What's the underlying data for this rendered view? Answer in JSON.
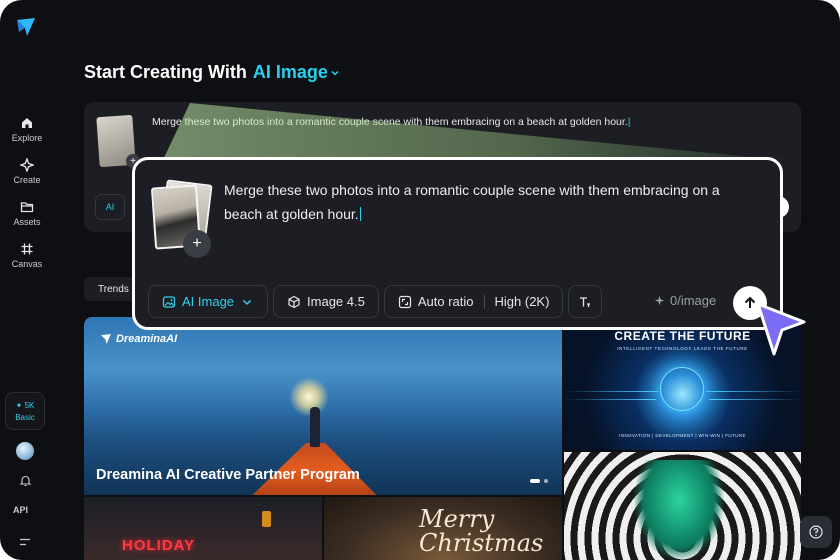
{
  "sidebar": {
    "items": [
      {
        "label": "Explore",
        "icon": "home-icon"
      },
      {
        "label": "Create",
        "icon": "sparkle-icon"
      },
      {
        "label": "Assets",
        "icon": "folder-icon"
      },
      {
        "label": "Canvas",
        "icon": "hash-icon"
      }
    ],
    "credits": "5K",
    "plan": "Basic",
    "api_label": "API"
  },
  "heading": {
    "prefix": "Start Creating With",
    "mode": "AI Image"
  },
  "background_prompt": {
    "text": "Merge these two photos into a romantic couple scene with them embracing on a beach at golden hour.",
    "mode_short": "AI"
  },
  "tabs": {
    "active": "Trends"
  },
  "gallery": {
    "banner_brand": "DreaminaAI",
    "banner_title": "Dreamina AI Creative Partner Program",
    "future_title": "CREATE THE FUTURE",
    "future_subtitle": "INTELLIGENT TECHNOLOGY LEADS THE FUTURE",
    "future_footer": "INNOVATION | DEVELOPMENT | WIN-WIN | FUTURE",
    "holiday_sign": "HOLIDAY",
    "xmas_script": "Merry Christmas"
  },
  "prompt_card": {
    "text": "Merge these two photos into a romantic couple scene with them embracing on a beach at golden hour.",
    "toolbar": {
      "mode": "AI Image",
      "model": "Image 4.5",
      "ratio": "Auto ratio",
      "quality": "High (2K)"
    },
    "credits_label": "0/image"
  },
  "colors": {
    "accent": "#28d2ee",
    "background": "#0e0f12",
    "card": "#1c1e23",
    "cursor": "#7b6cf6"
  }
}
